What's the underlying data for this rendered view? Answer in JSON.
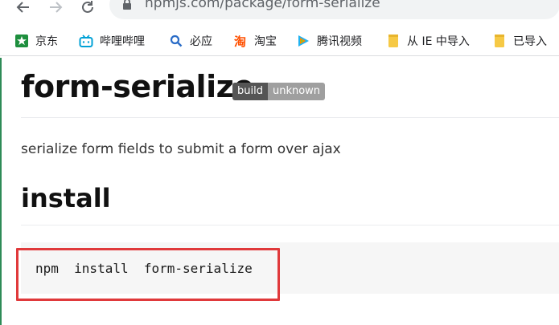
{
  "browser": {
    "url": "npmjs.com/package/form-serialize",
    "bookmarks": [
      {
        "label": "京东",
        "icon": "jd-icon"
      },
      {
        "label": "哔哩哔哩",
        "icon": "bilibili-icon"
      },
      {
        "label": "必应",
        "icon": "bing-search-icon"
      },
      {
        "label": "淘宝",
        "icon": "taobao-icon"
      },
      {
        "label": "腾讯视频",
        "icon": "tencent-video-icon"
      },
      {
        "label": "从 IE 中导入",
        "icon": "folder-icon"
      },
      {
        "label": "已导入",
        "icon": "folder-icon"
      }
    ]
  },
  "package": {
    "name": "form-serialize",
    "badge_left": "build",
    "badge_right": "unknown",
    "description": "serialize form fields to submit a form over ajax",
    "install_heading": "install",
    "install_command": "npm  install  form-serialize"
  },
  "colors": {
    "highlight": "#e0393b",
    "badge_left": "#555555",
    "badge_right": "#9f9f9f",
    "code_bg": "#f6f6f6"
  }
}
